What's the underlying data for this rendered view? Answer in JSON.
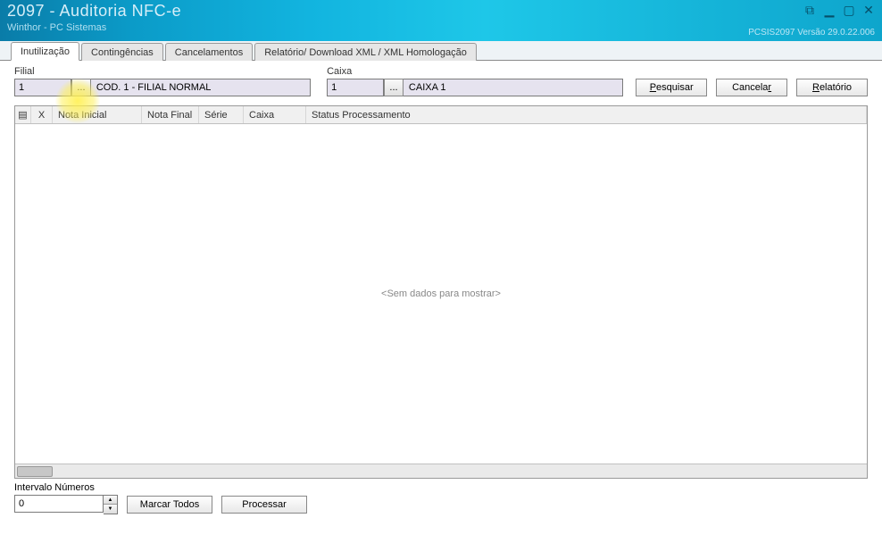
{
  "header": {
    "title": "2097 - Auditoria NFC-e",
    "subtitle": "Winthor - PC Sistemas",
    "version": "PCSIS2097   Versão  29.0.22.006"
  },
  "tabs": [
    {
      "label": "Inutilização",
      "active": true
    },
    {
      "label": "Contingências",
      "active": false
    },
    {
      "label": "Cancelamentos",
      "active": false
    },
    {
      "label": "Relatório/ Download XML / XML Homologação",
      "active": false
    }
  ],
  "filters": {
    "filial_label": "Filial",
    "filial_value": "1",
    "filial_display": "COD. 1 - FILIAL NORMAL",
    "caixa_label": "Caixa",
    "caixa_value": "1",
    "caixa_display": "CAIXA 1",
    "lookup_btn": "...",
    "btn_pesquisar_pre": "P",
    "btn_pesquisar_rest": "esquisar",
    "btn_cancelar_pre": "Cancela",
    "btn_cancelar_rest": "r",
    "btn_relatorio_pre": "R",
    "btn_relatorio_rest": "elatório"
  },
  "grid": {
    "columns": [
      "X",
      "Nota Inicial",
      "Nota Final",
      "Série",
      "Caixa",
      "Status Processamento"
    ],
    "empty_text": "<Sem dados para mostrar>"
  },
  "bottom": {
    "intervalo_label": "Intervalo Números",
    "intervalo_value": "0",
    "btn_marcar": "Marcar Todos",
    "btn_processar": "Processar"
  }
}
